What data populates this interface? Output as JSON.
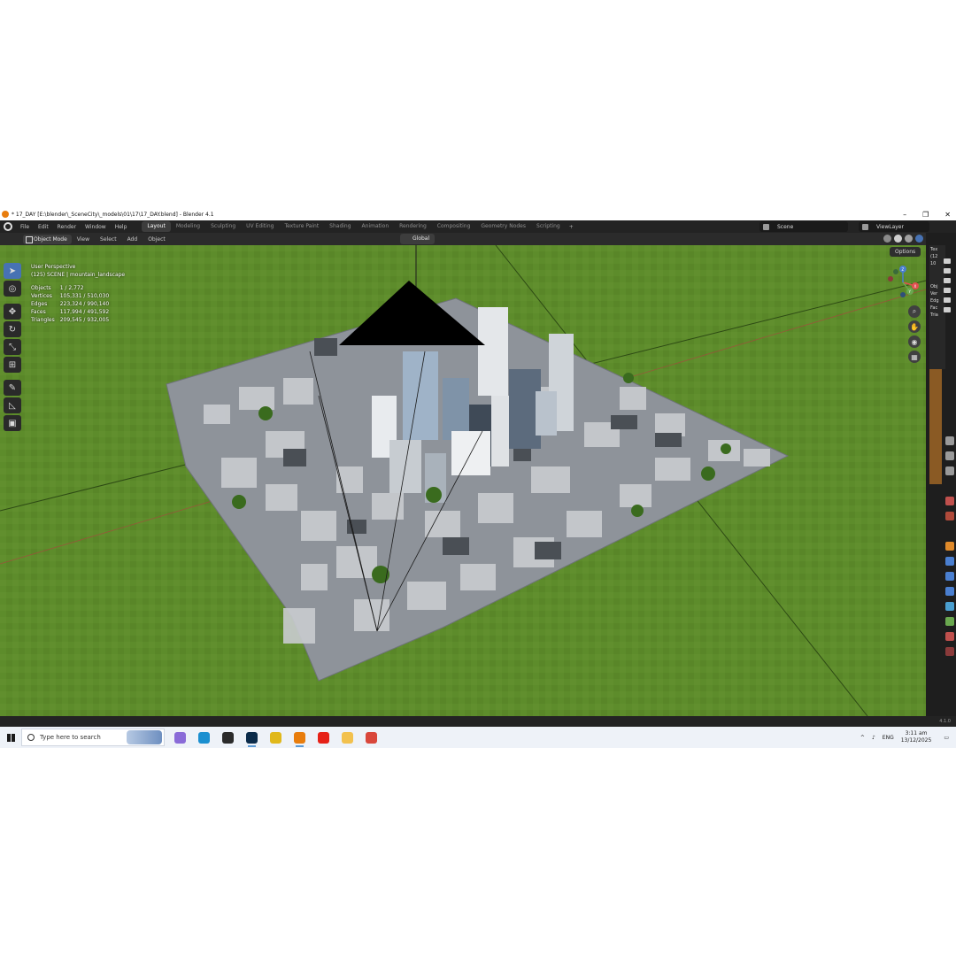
{
  "window": {
    "title": "* 17_DAY [E:\\blender\\_SceneCity\\_models\\01\\17\\17_DAY.blend] - Blender 4.1",
    "controls": [
      "–",
      "❐",
      "✕"
    ]
  },
  "topbar": {
    "menus": [
      "File",
      "Edit",
      "Render",
      "Window",
      "Help"
    ],
    "workspaces": [
      "Layout",
      "Modeling",
      "Sculpting",
      "UV Editing",
      "Texture Paint",
      "Shading",
      "Animation",
      "Rendering",
      "Compositing",
      "Geometry Nodes",
      "Scripting"
    ],
    "active_workspace": "Layout",
    "add_label": "+",
    "scene_label": "Scene",
    "view_layer_label": "ViewLayer"
  },
  "header": {
    "mode": "Object Mode",
    "menus": [
      "View",
      "Select",
      "Add",
      "Object"
    ],
    "orientation": "Global"
  },
  "viewport": {
    "view_name": "User Perspective",
    "collection": "(125) SCENE | mountain_landscape",
    "stats": [
      {
        "label": "Objects",
        "value": "1 / 2,772"
      },
      {
        "label": "Vertices",
        "value": "105,331 / 510,030"
      },
      {
        "label": "Edges",
        "value": "223,324 / 990,140"
      },
      {
        "label": "Faces",
        "value": "117,994 / 491,592"
      },
      {
        "label": "Triangles",
        "value": "209,545 / 932,005"
      }
    ],
    "options_label": "Options",
    "gizmo_axes": [
      "X",
      "Y",
      "Z"
    ],
    "ground_color": "#5b8a2a"
  },
  "outliner_fragment": [
    "Tex",
    "(12",
    "10"
  ],
  "props_fragment": [
    "Obj",
    "Ver",
    "Edg",
    "Fac",
    "Tria"
  ],
  "status": {
    "version": "4.1.0"
  },
  "taskbar": {
    "search_placeholder": "Type here to search",
    "apps": [
      {
        "name": "copilot-icon",
        "color": "#8a6bd8",
        "running": false
      },
      {
        "name": "edge-icon",
        "color": "#1b8fd0",
        "running": false
      },
      {
        "name": "steam-icon",
        "color": "#2b2b2b",
        "running": false
      },
      {
        "name": "photoshop-icon",
        "color": "#0b2b4a",
        "running": true
      },
      {
        "name": "chrome-icon",
        "color": "#e0b81b",
        "running": false
      },
      {
        "name": "blender-icon",
        "color": "#e87d0d",
        "running": true
      },
      {
        "name": "youtube-icon",
        "color": "#e62117",
        "running": false
      },
      {
        "name": "file-explorer-icon",
        "color": "#f2c14e",
        "running": false
      },
      {
        "name": "chrome-alt-icon",
        "color": "#d9473b",
        "running": false
      }
    ],
    "language": "ENG",
    "time": "3:11 am",
    "date": "13/12/2025"
  }
}
